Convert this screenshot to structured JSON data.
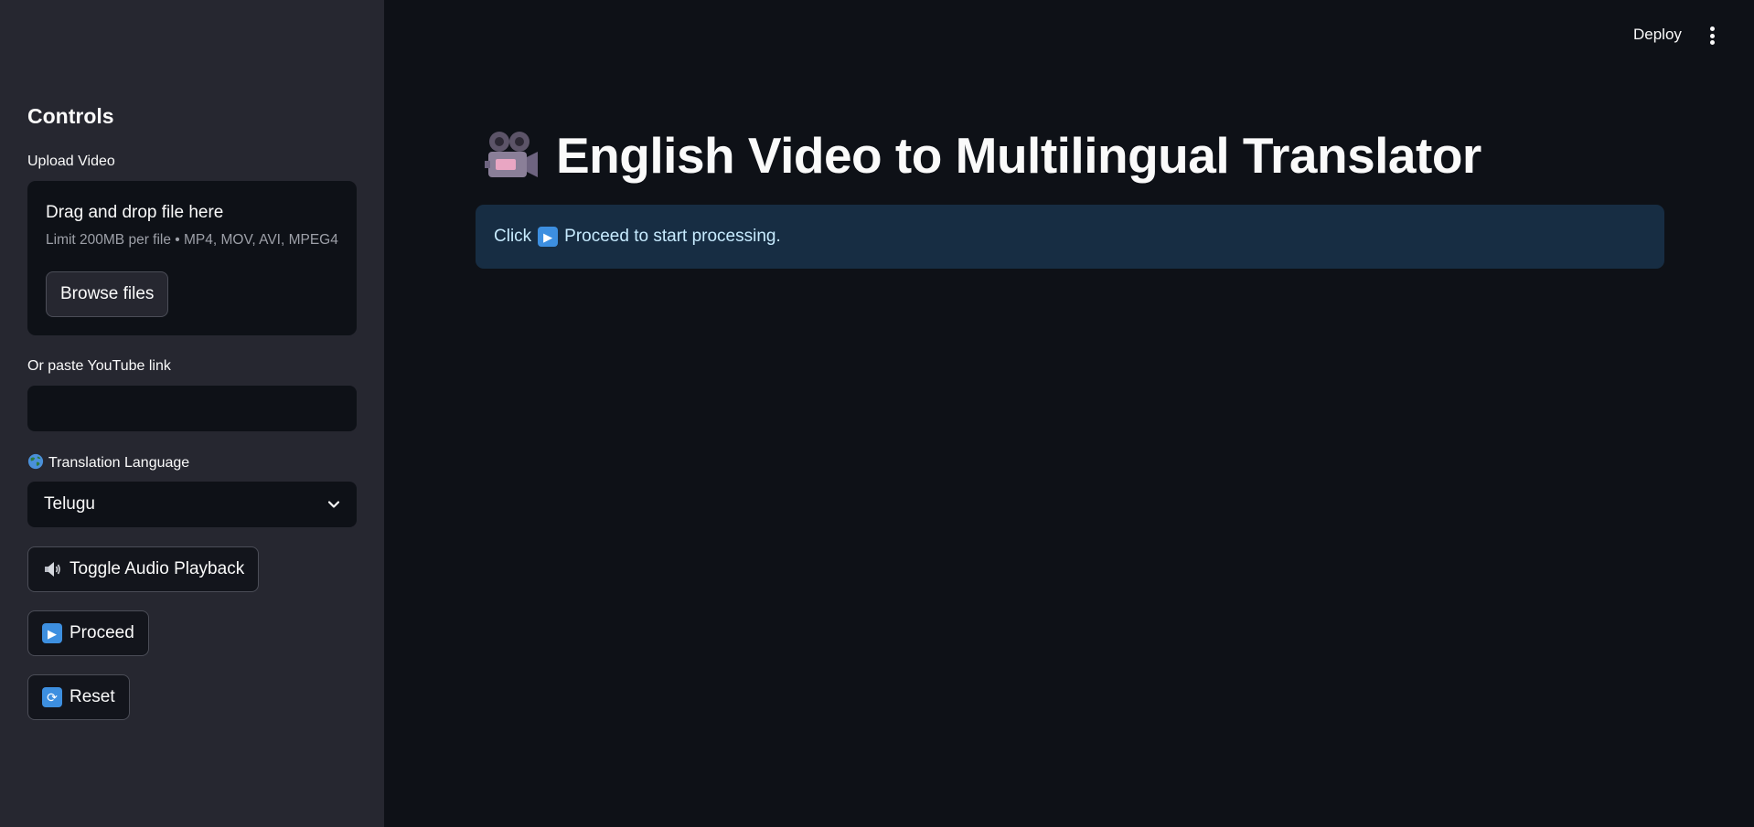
{
  "header": {
    "deploy_label": "Deploy",
    "menu_icon": "kebab-menu-icon"
  },
  "sidebar": {
    "heading": "Controls",
    "upload": {
      "label": "Upload Video",
      "dropzone_title": "Drag and drop file here",
      "limit_text": "Limit 200MB per file • MP4, MOV, AVI, MPEG4",
      "browse_label": "Browse files"
    },
    "youtube": {
      "label": "Or paste YouTube link",
      "value": "",
      "placeholder": ""
    },
    "language": {
      "label": "Translation Language",
      "icon": "globe-icon",
      "selected": "Telugu"
    },
    "buttons": {
      "toggle_audio": {
        "icon": "speaker-icon",
        "label": "Toggle Audio Playback"
      },
      "proceed": {
        "icon": "play-button-icon",
        "label": "Proceed"
      },
      "reset": {
        "icon": "reset-arrows-icon",
        "label": "Reset"
      }
    }
  },
  "main": {
    "title_icon": "movie-camera-icon",
    "title": "English Video to Multilingual Translator",
    "info": {
      "prefix": "Click",
      "icon": "play-button-icon",
      "suffix": "Proceed to start processing."
    }
  },
  "colors": {
    "background": "#0e1117",
    "sidebar": "#262730",
    "info_bg": "#172d43",
    "info_text": "#c7ebff",
    "emoji_blue": "#3d8fe0"
  }
}
